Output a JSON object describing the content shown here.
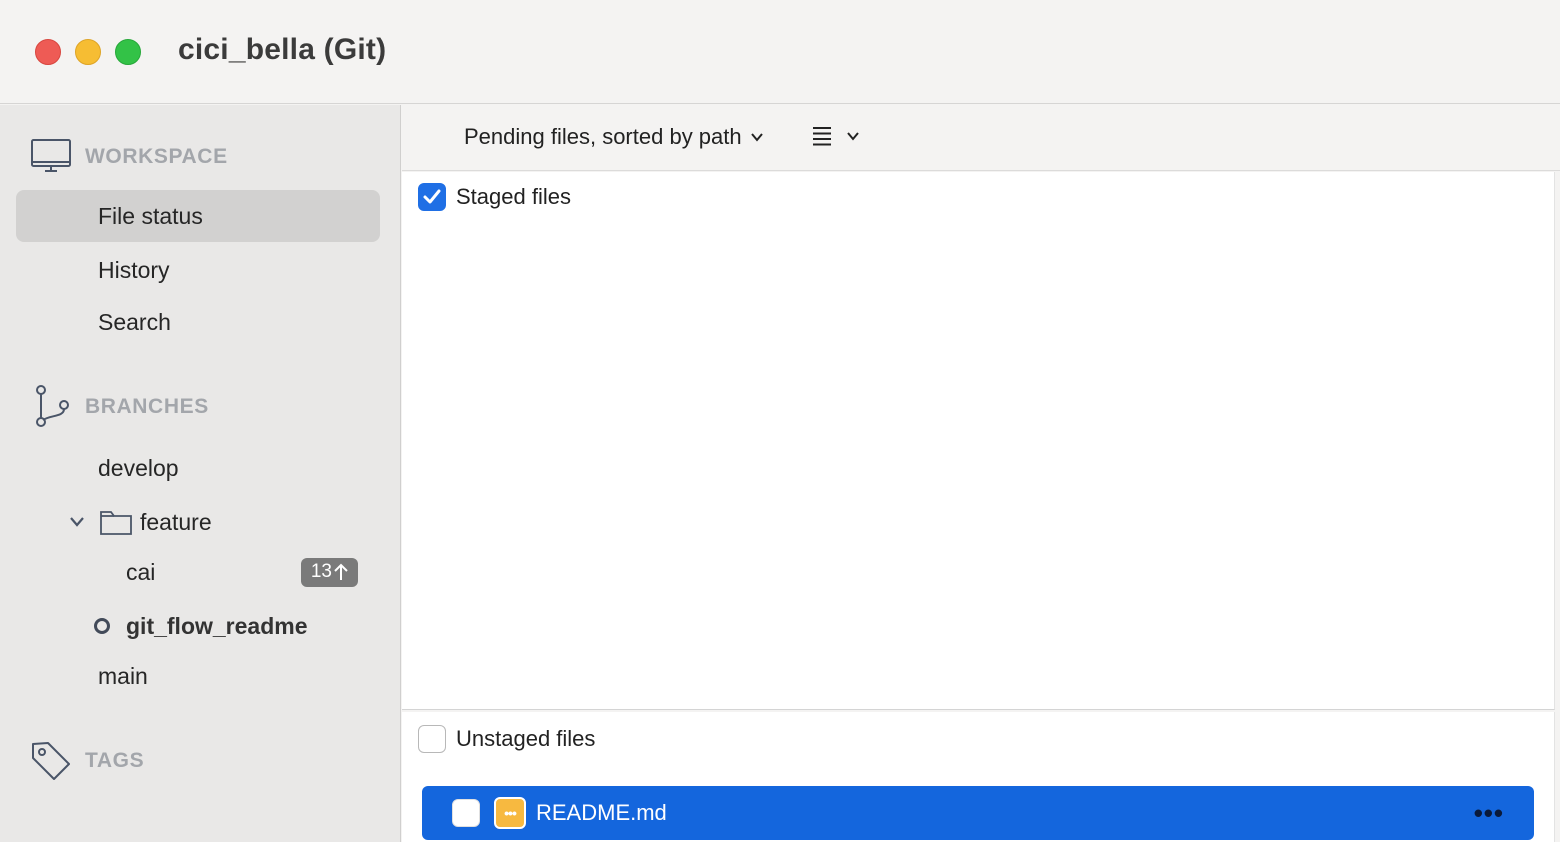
{
  "window": {
    "title": "cici_bella (Git)"
  },
  "sidebar": {
    "workspace": {
      "heading": "WORKSPACE",
      "items": [
        {
          "label": "File status",
          "selected": true
        },
        {
          "label": "History",
          "selected": false
        },
        {
          "label": "Search",
          "selected": false
        }
      ]
    },
    "branches": {
      "heading": "BRANCHES",
      "develop": "develop",
      "feature_folder": "feature",
      "cai": "cai",
      "cai_badge": "13",
      "current": "git_flow_readme",
      "main": "main"
    },
    "tags": {
      "heading": "TAGS"
    }
  },
  "toolbar": {
    "sort_label": "Pending files, sorted by path"
  },
  "staged": {
    "label": "Staged files",
    "checked": true
  },
  "unstaged": {
    "label": "Unstaged files",
    "checked": false,
    "files": [
      {
        "name": "README.md",
        "status": "modified",
        "selected": true
      }
    ]
  },
  "colors": {
    "selection_blue": "#1466dd",
    "checkbox_blue": "#1f6fe5",
    "modified_orange": "#f7b940",
    "badge_gray": "#7a7a7a"
  },
  "icons": {
    "workspace": "monitor-icon",
    "branches": "branch-icon",
    "tags": "tag-icon",
    "folder": "folder-icon",
    "view": "list-view-icon"
  }
}
